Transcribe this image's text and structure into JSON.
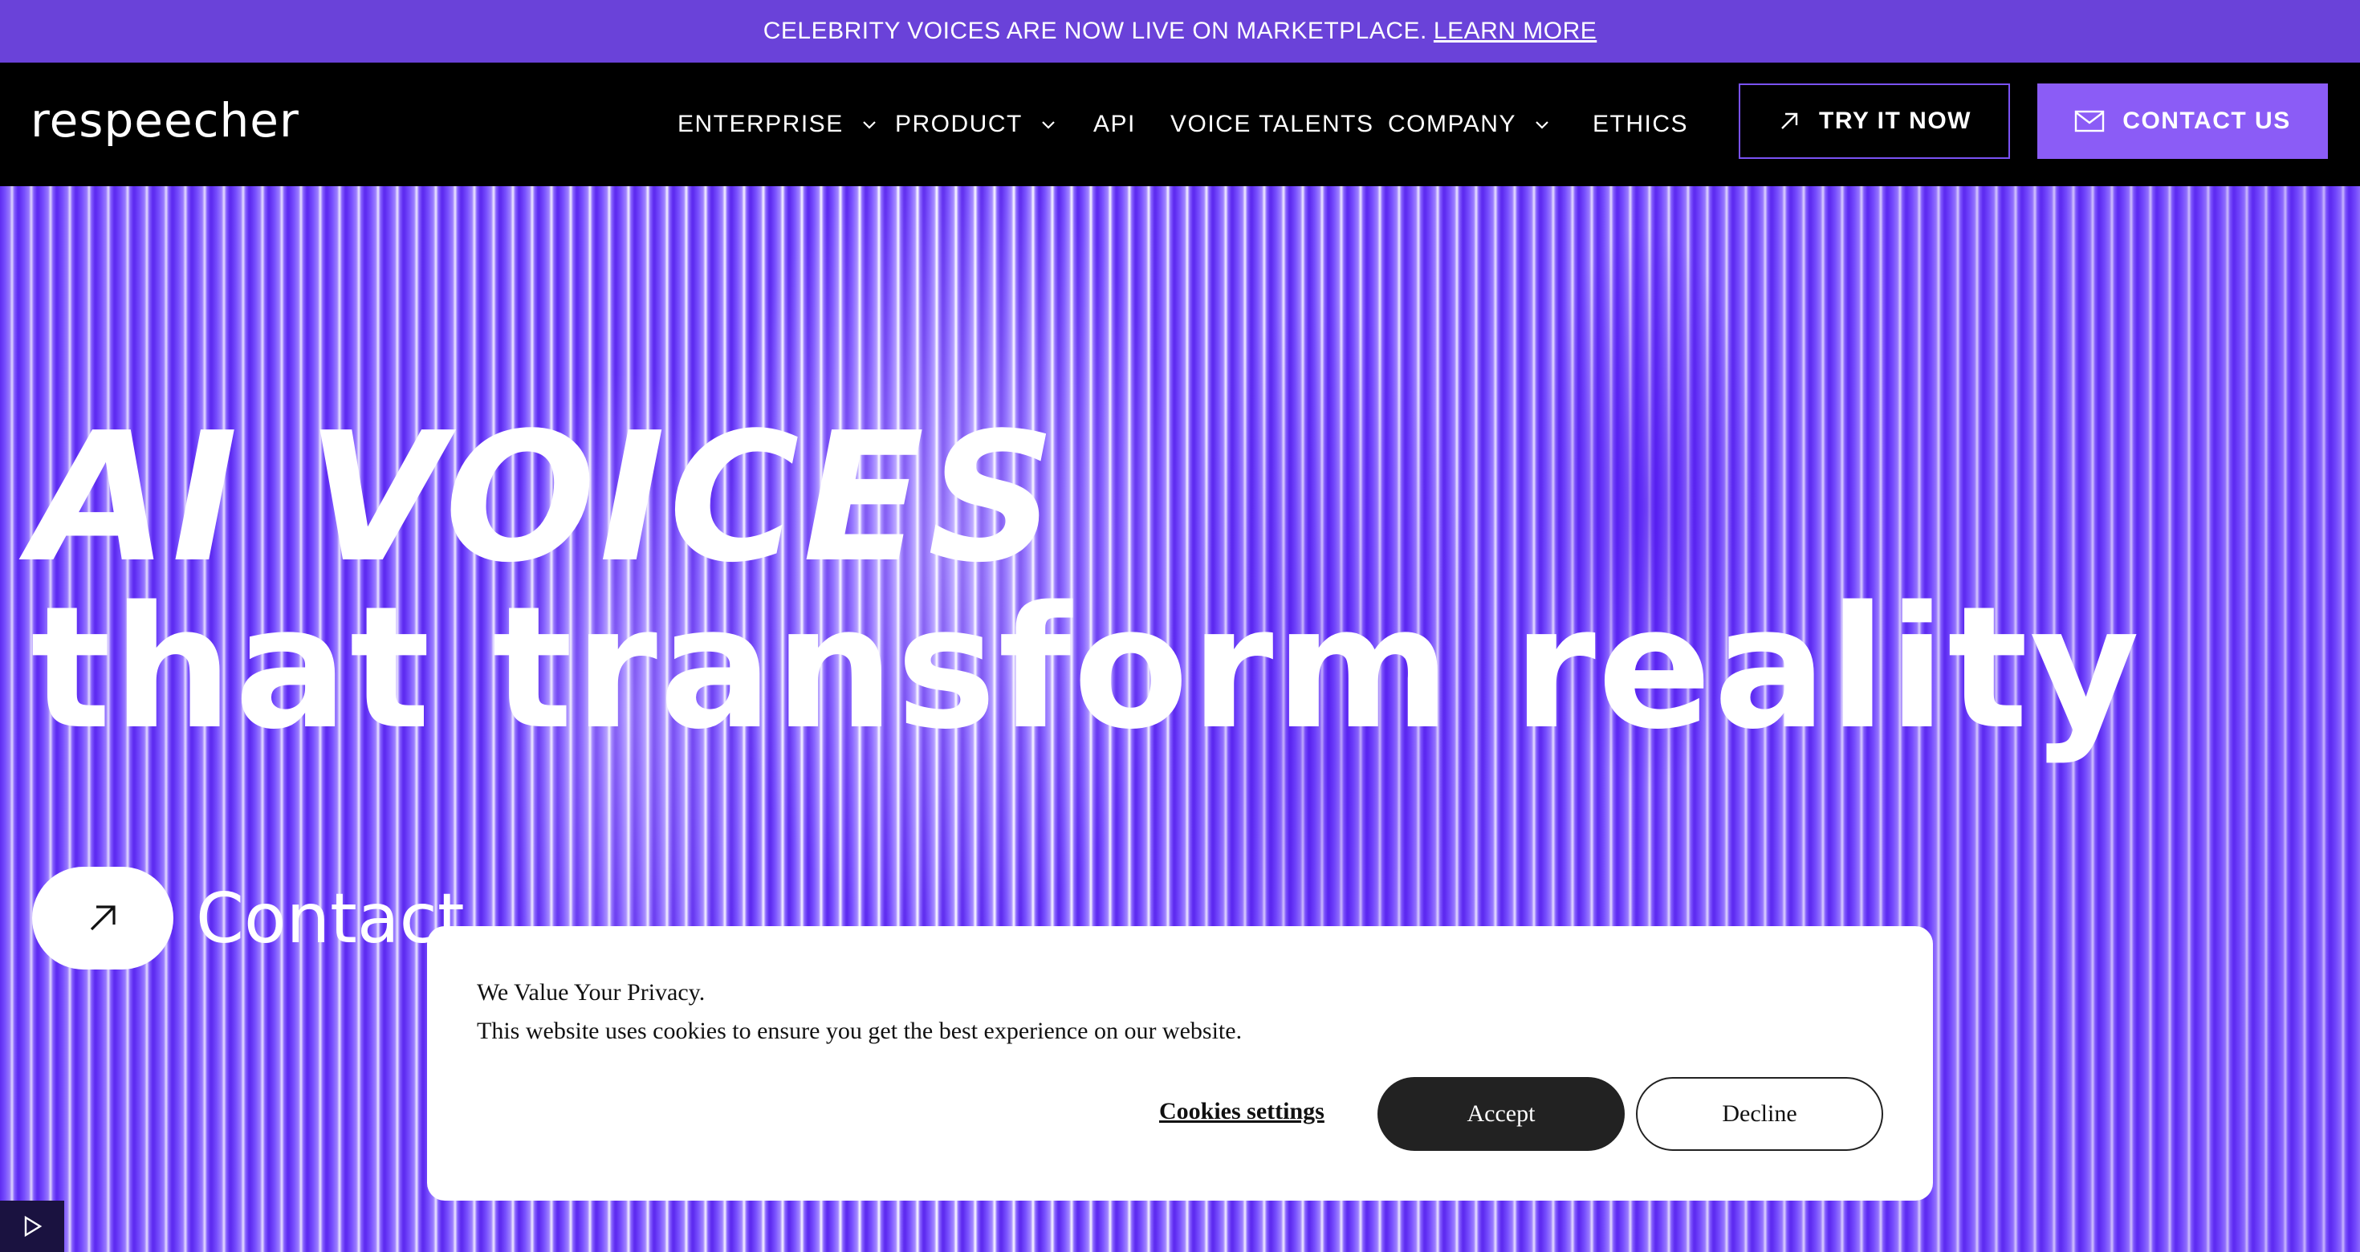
{
  "announcement": {
    "text": "CELEBRITY VOICES ARE NOW LIVE ON MARKETPLACE.",
    "link": "LEARN MORE"
  },
  "nav": {
    "logo": "respeecher",
    "items": [
      {
        "label": "ENTERPRISE",
        "dropdown": true
      },
      {
        "label": "PRODUCT",
        "dropdown": true
      },
      {
        "label": "API",
        "dropdown": false
      },
      {
        "label": "VOICE TALENTS",
        "dropdown": false
      },
      {
        "label": "COMPANY",
        "dropdown": true
      },
      {
        "label": "ETHICS",
        "dropdown": false
      }
    ],
    "try_now": "TRY IT NOW",
    "contact": "CONTACT US"
  },
  "hero": {
    "headline_line1": "AI VOICES",
    "headline_line2": "that transform reality",
    "cta_label": "Contact"
  },
  "cookie": {
    "title": "We Value Your Privacy.",
    "text": "This website uses cookies to ensure you get the best experience on our website.",
    "settings": "Cookies settings",
    "accept": "Accept",
    "decline": "Decline"
  },
  "colors": {
    "accent": "#8b5cf6",
    "announcement_bg": "#6a42d9",
    "nav_bg": "#000000"
  }
}
